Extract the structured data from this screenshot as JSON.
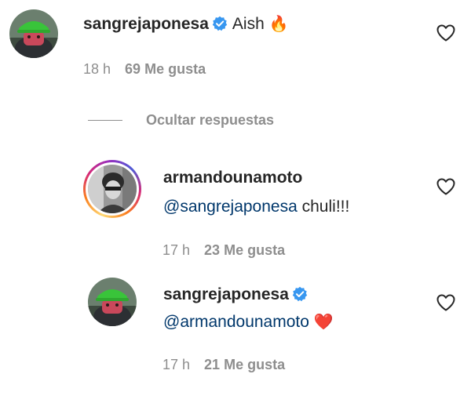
{
  "comment": {
    "username": "sangrejaponesa",
    "text": "Aish",
    "emoji": "🔥",
    "time": "18 h",
    "likes": "69 Me gusta"
  },
  "toggle_replies": {
    "label": "Ocultar respuestas"
  },
  "replies": [
    {
      "username": "armandounamoto",
      "mention": "@sangrejaponesa",
      "text": "chuli!!!",
      "time": "17 h",
      "likes": "23 Me gusta"
    },
    {
      "username": "sangrejaponesa",
      "mention": "@armandounamoto",
      "emoji": "❤️",
      "time": "17 h",
      "likes": "21 Me gusta"
    }
  ],
  "icons": {
    "verified": "verified-badge-icon",
    "like": "heart-outline-icon"
  },
  "colors": {
    "text": "#262626",
    "meta": "#8e8e8e",
    "mention": "#00376b",
    "verified": "#3897f0",
    "heart_emoji": "#e0245e"
  }
}
